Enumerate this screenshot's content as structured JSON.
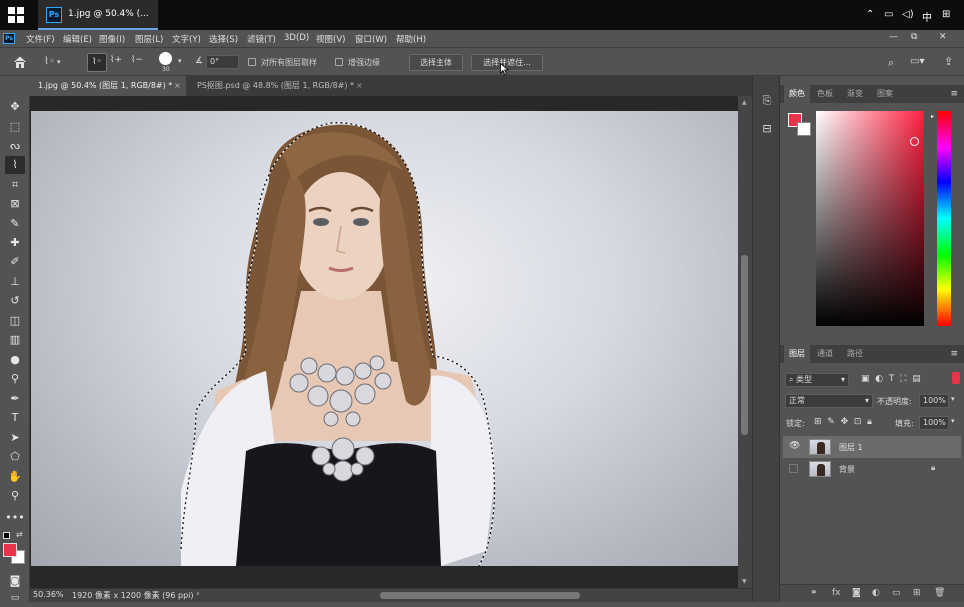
{
  "taskbar": {
    "window_title": "1.jpg @ 50.4% (...",
    "ps_badge": "Ps",
    "tray_lang": "中",
    "tray_icons": [
      "chevron-up-icon",
      "network-icon",
      "volume-icon",
      "input-method-icon",
      "grid-icon"
    ]
  },
  "app": {
    "logo": "Ps"
  },
  "menubar": {
    "items": [
      "文件(F)",
      "编辑(E)",
      "图像(I)",
      "图层(L)",
      "文字(Y)",
      "选择(S)",
      "滤镜(T)",
      "3D(D)",
      "视图(V)",
      "窗口(W)",
      "帮助(H)"
    ]
  },
  "window_controls": {
    "minimize": "—",
    "restore": "⧉",
    "close": "✕"
  },
  "options": {
    "brush_size": "30",
    "angle_value": "0°",
    "sample_all_layers": "对所有图层取样",
    "enhance_edge": "增强边缘",
    "select_subject": "选择主体",
    "select_and_mask": "选择并遮住..."
  },
  "doc_tabs": [
    {
      "label": "1.jpg @ 50.4% (图层 1, RGB/8#) *",
      "close": "×"
    },
    {
      "label": "PS抠图.psd @ 48.8% (图层 1, RGB/8#) *",
      "close": "×"
    }
  ],
  "status": {
    "zoom": "50.36%",
    "doc_info": "1920 像素 x 1200 像素 (96 ppi)",
    "arrow": "›"
  },
  "colors": {
    "foreground": "#e8344a",
    "background": "#ffffff",
    "accent": "#31a8ff"
  },
  "panels": {
    "color_tabs": [
      "颜色",
      "色板",
      "渐变",
      "图案"
    ],
    "layers_tabs": [
      "图层",
      "通道",
      "路径"
    ],
    "filter_kind": "类型",
    "blend_mode": "正常",
    "opacity_label": "不透明度:",
    "opacity_value": "100%",
    "lock_label": "锁定:",
    "fill_label": "填充:",
    "fill_value": "100%",
    "layers": [
      {
        "name": "图层 1",
        "visible": true,
        "locked": false,
        "selected": true
      },
      {
        "name": "背景",
        "visible": false,
        "locked": true,
        "selected": false
      }
    ]
  }
}
